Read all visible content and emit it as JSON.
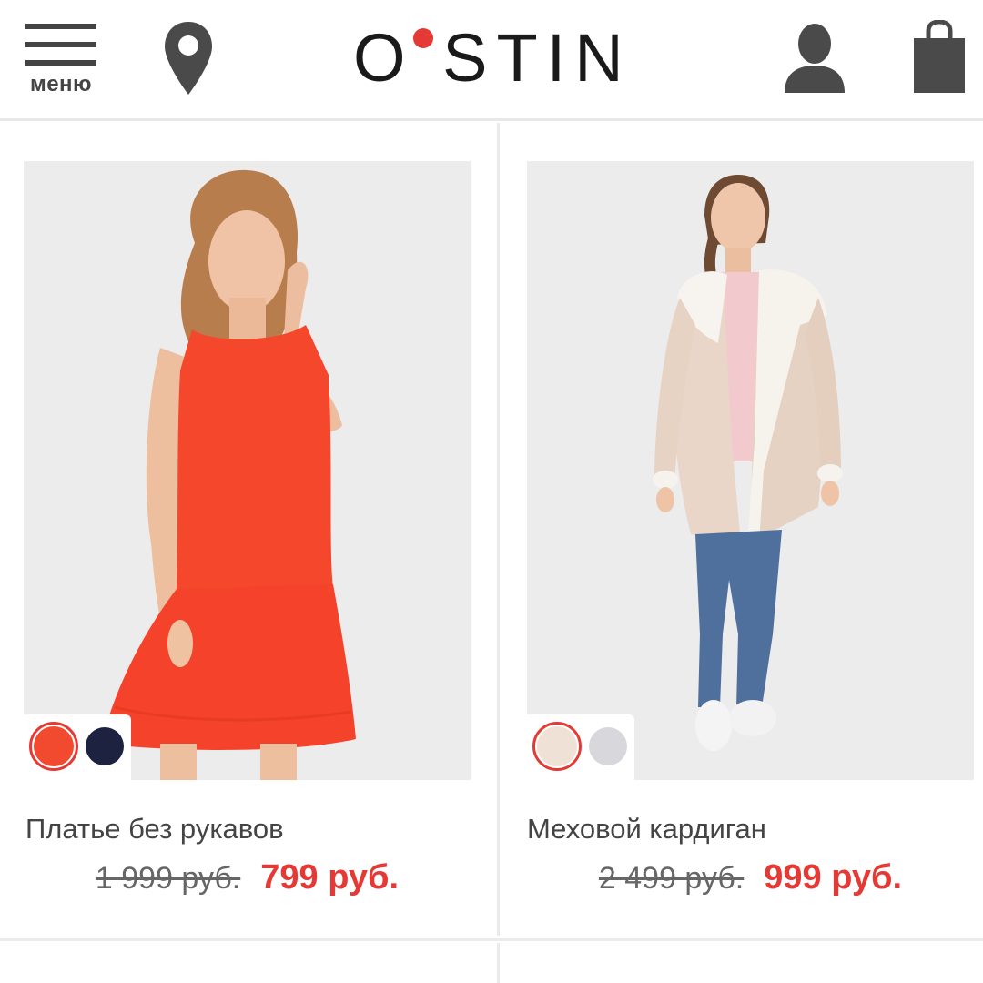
{
  "header": {
    "menu_label": "меню",
    "logo_text": "O·STIN",
    "logo_left": "O",
    "logo_right": "STIN",
    "icons": [
      "hamburger-menu-icon",
      "location-pin-icon",
      "user-icon",
      "shopping-bag-icon"
    ]
  },
  "products": [
    {
      "title": "Платье без рукавов",
      "old_price": "1 999 руб.",
      "new_price": "799 руб.",
      "colors": [
        "#f24a2e",
        "#1c2240"
      ],
      "selected_color": 0
    },
    {
      "title": "Меховой кардиган",
      "old_price": "2 499 руб.",
      "new_price": "999 руб.",
      "colors": [
        "#efe1d6",
        "#d8d8dc"
      ],
      "selected_color": 0
    }
  ],
  "colors": {
    "accent": "#e53935",
    "text": "#444444",
    "image_bg": "#ececed"
  }
}
